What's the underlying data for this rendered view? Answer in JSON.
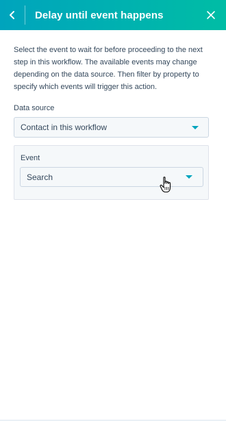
{
  "header": {
    "title": "Delay until event happens",
    "back_icon": "chevron-left-icon",
    "close_icon": "close-icon",
    "gradient_start": "#00a4bd",
    "gradient_end": "#00bda5"
  },
  "description": "Select the event to wait for before proceeding to the next step in this workflow. The available events may change depending on the data source. Then filter by property to specify which events will trigger this action.",
  "data_source": {
    "label": "Data source",
    "value": "Contact in this workflow"
  },
  "event": {
    "label": "Event",
    "value": "Search"
  },
  "colors": {
    "accent": "#00a4bd",
    "text": "#33475b",
    "field_bg": "#f5f8fa",
    "border": "#cbd6e2"
  }
}
